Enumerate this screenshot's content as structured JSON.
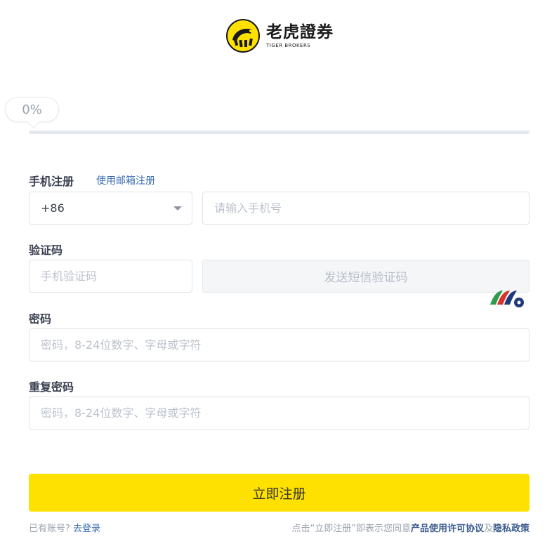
{
  "brand": {
    "name_cn": "老虎證券",
    "name_en": "TIGER BROKERS",
    "color": "#FFE100"
  },
  "progress": {
    "label": "0%",
    "value": 0
  },
  "phone": {
    "label": "手机注册",
    "switch_link": "使用邮箱注册",
    "country_code": "+86",
    "placeholder": "请输入手机号"
  },
  "code": {
    "label": "验证码",
    "placeholder": "手机验证码",
    "send_button": "发送短信验证码"
  },
  "password": {
    "label": "密码",
    "placeholder": "密码，8-24位数字、字母或字符"
  },
  "confirm_password": {
    "label": "重复密码",
    "placeholder": "密码，8-24位数字、字母或字符"
  },
  "submit_label": "立即注册",
  "footer": {
    "have_account": "已有账号?",
    "login_link": "去登录",
    "agree_prefix": "点击“立即注册”即表示您同意",
    "terms_link": "产品使用许可协议",
    "and": "及",
    "privacy_link": "隐私政策"
  }
}
